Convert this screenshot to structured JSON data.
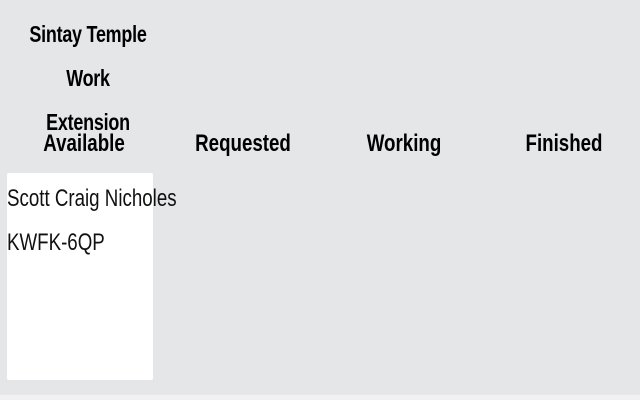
{
  "app": {
    "title": "Sintay Temple Work Extension"
  },
  "board": {
    "columns": [
      {
        "label": "Available"
      },
      {
        "label": "Requested"
      },
      {
        "label": "Working"
      },
      {
        "label": "Finished"
      }
    ],
    "cards": [
      {
        "column": "Available",
        "name": "Scott Craig Nicholes",
        "id": "KWFK-6QP"
      }
    ]
  }
}
